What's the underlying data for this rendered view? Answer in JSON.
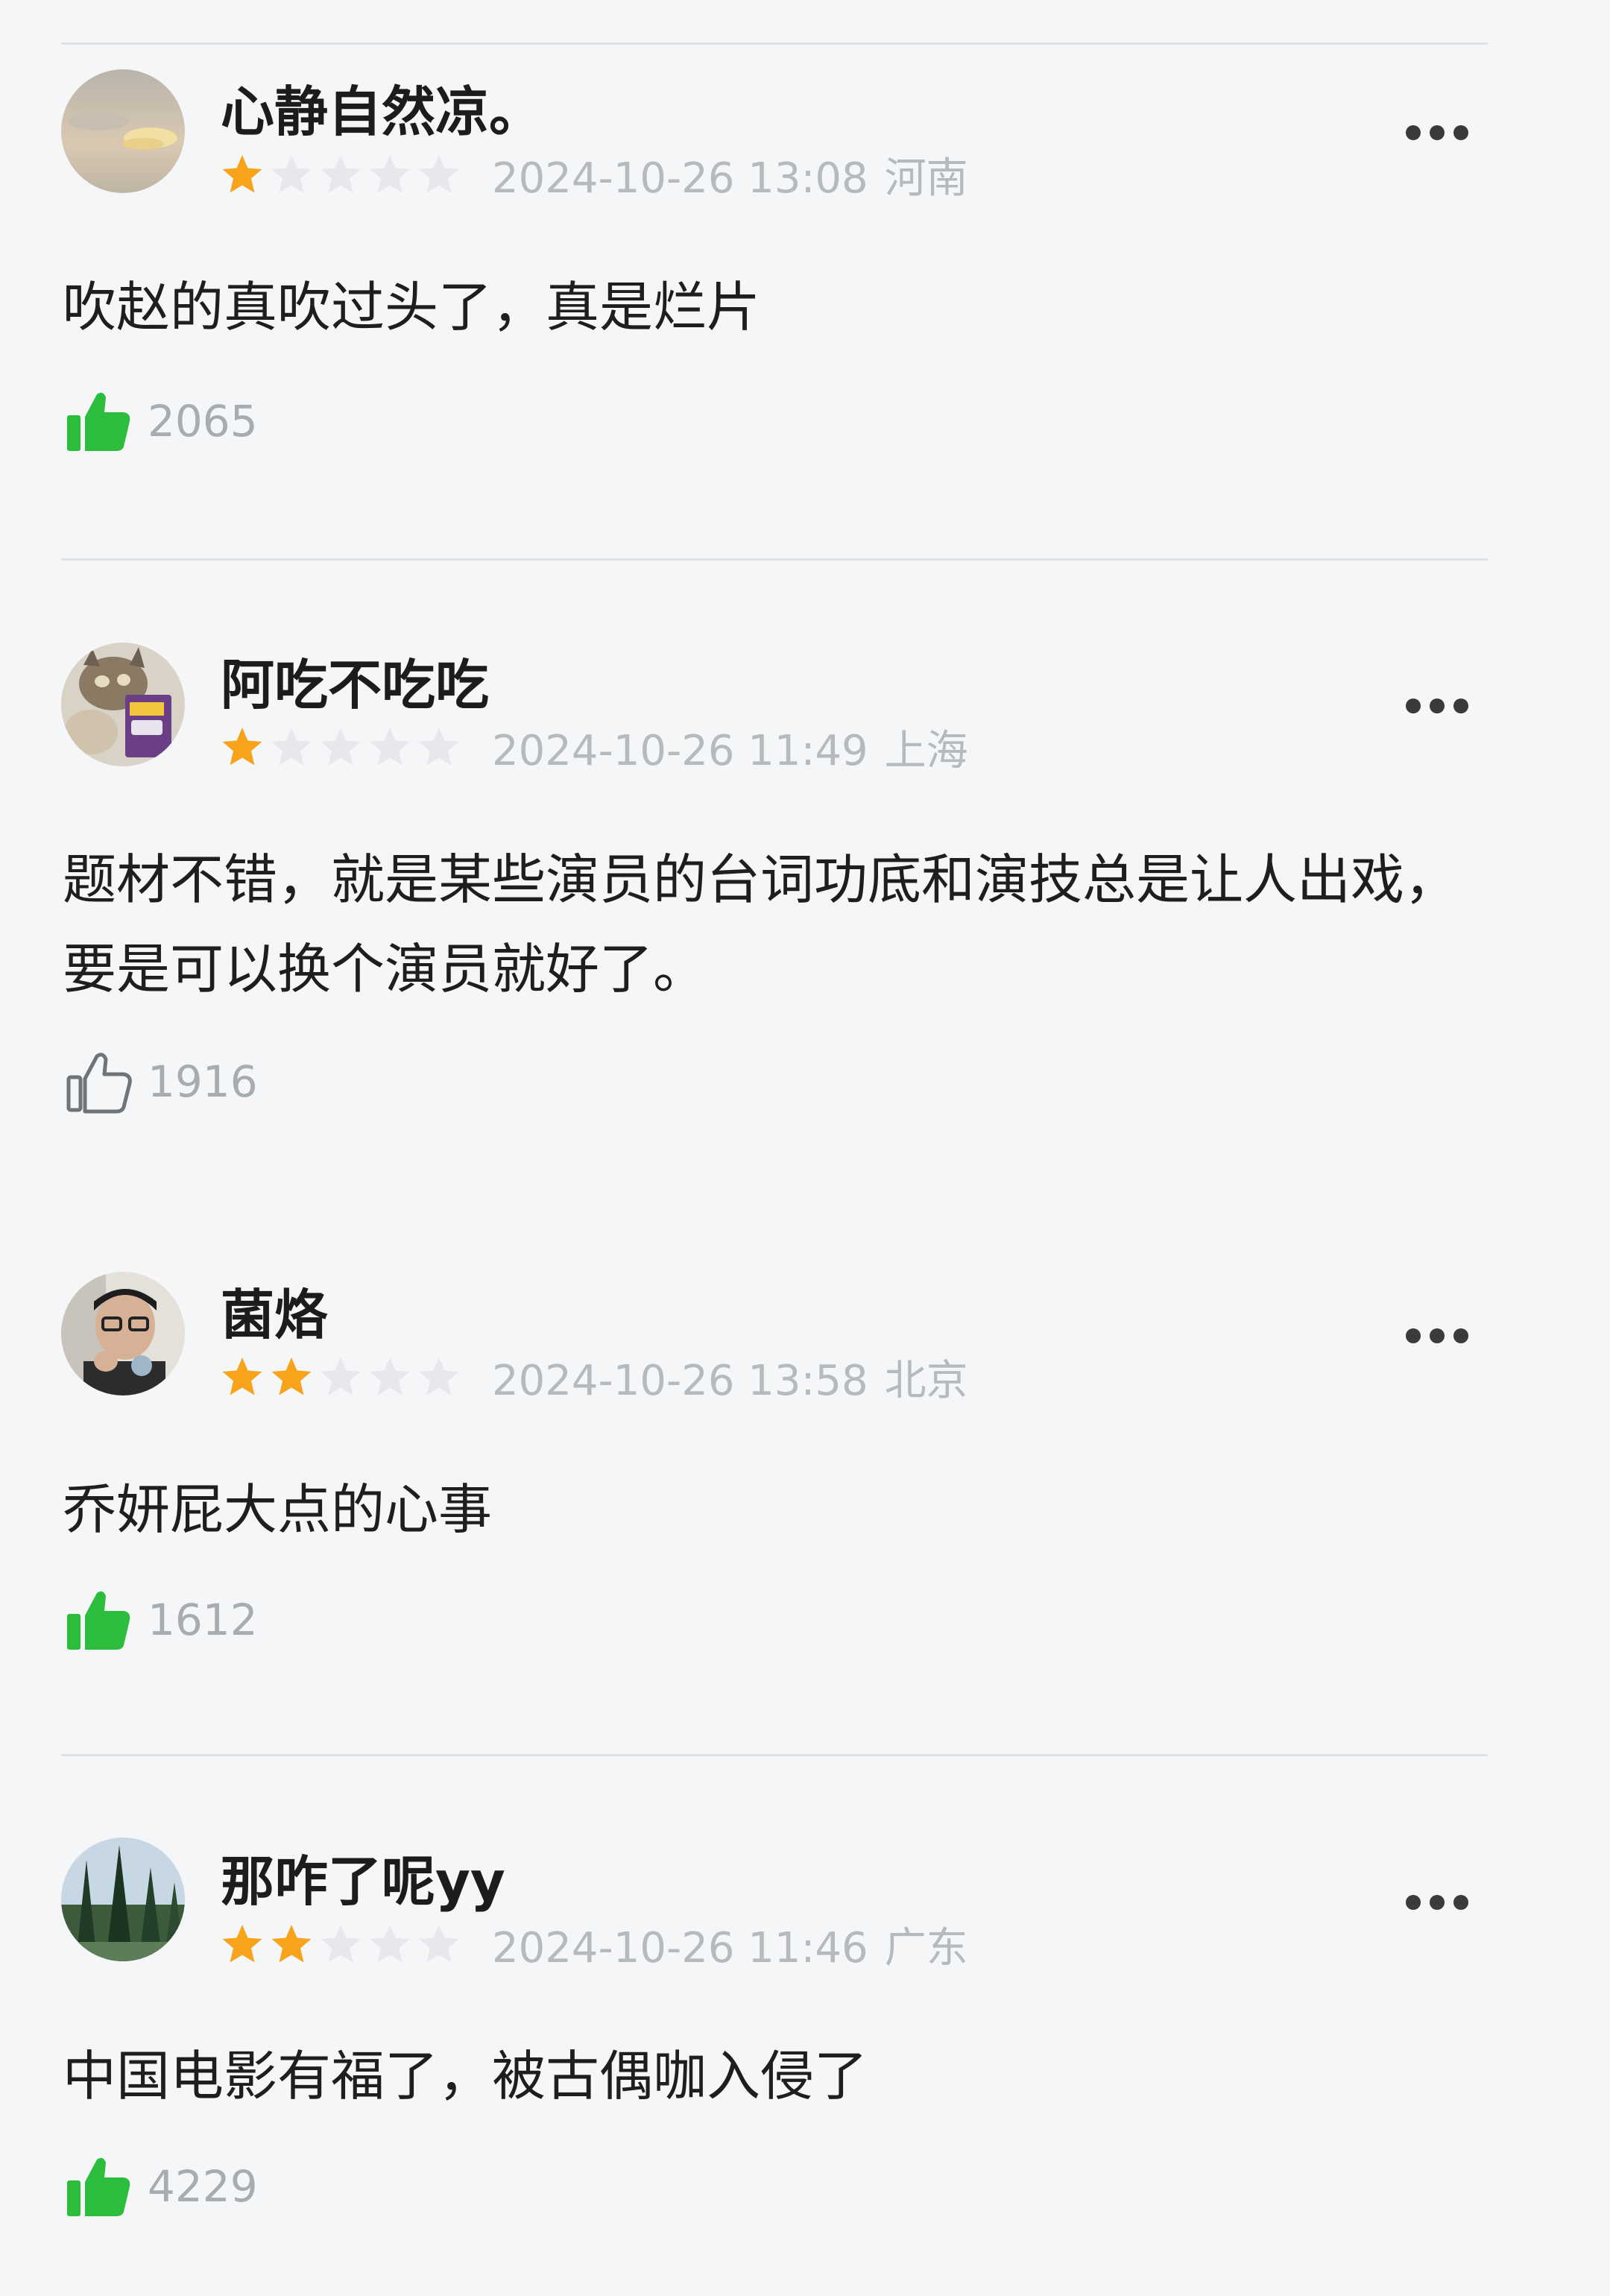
{
  "comments": [
    {
      "username": "心静自然凉。",
      "rating": 1,
      "datetime": "2024-10-26 13:08",
      "location": "河南",
      "content": "吹赵的真吹过头了，真是烂片",
      "likes": "2065",
      "liked": true
    },
    {
      "username": "阿吃不吃吃",
      "rating": 1,
      "datetime": "2024-10-26 11:49",
      "location": "上海",
      "content": "题材不错，就是某些演员的台词功底和演技总是让人出戏，要是可以换个演员就好了。",
      "likes": "1916",
      "liked": false
    },
    {
      "username": "菌烙",
      "rating": 2,
      "datetime": "2024-10-26 13:58",
      "location": "北京",
      "content": "乔妍屁大点的心事",
      "likes": "1612",
      "liked": true
    },
    {
      "username": "那咋了呢yy",
      "rating": 2,
      "datetime": "2024-10-26 11:46",
      "location": "广东",
      "content": "中国电影有福了，被古偶咖入侵了",
      "likes": "4229",
      "liked": true
    }
  ],
  "colors": {
    "star_filled": "#f7a41c",
    "star_empty": "#e6e8eb",
    "like_filled": "#2dbd3c",
    "like_outline": "#707478"
  },
  "icons": [
    "star-icon",
    "more-icon",
    "thumbs-up-icon"
  ]
}
